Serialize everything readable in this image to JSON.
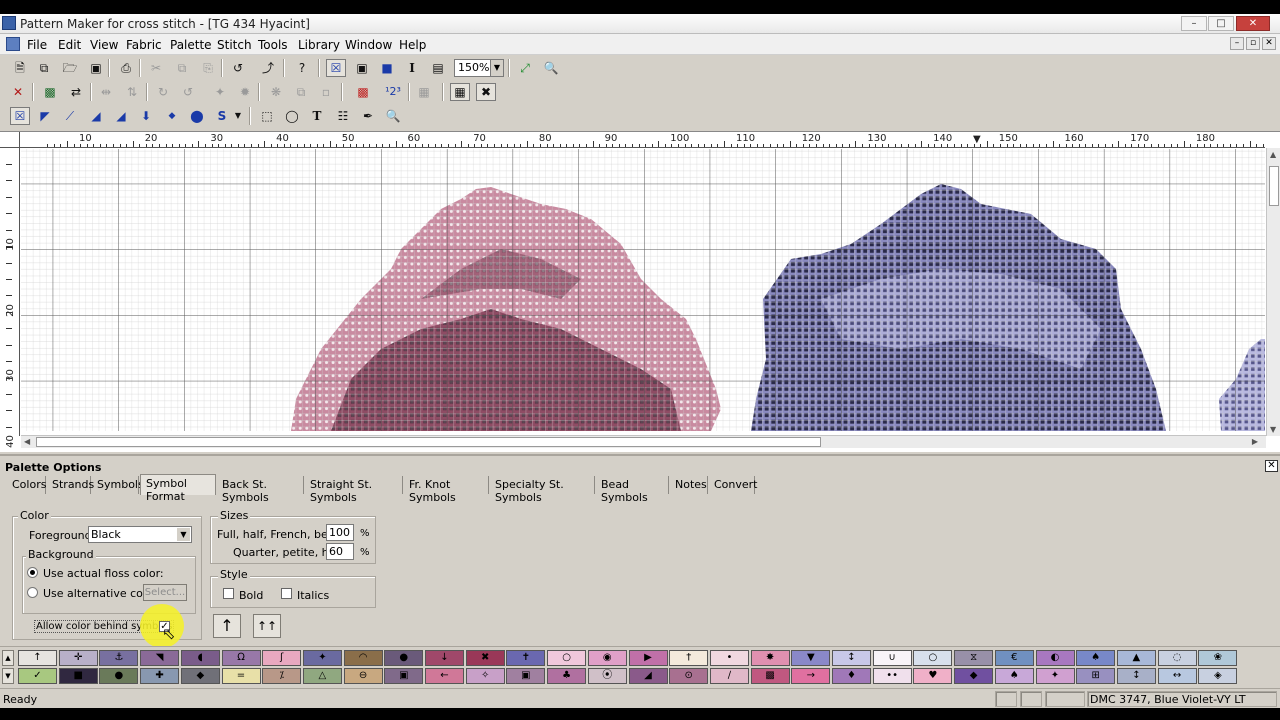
{
  "window": {
    "title": "Pattern Maker for cross stitch - [TG 434 Hyacint]",
    "min_label": "–",
    "max_label": "□",
    "close_label": "✕"
  },
  "menu": [
    "File",
    "Edit",
    "View",
    "Fabric",
    "Palette",
    "Stitch",
    "Tools",
    "Library",
    "Window",
    "Help"
  ],
  "toolbar1": {
    "zoom_value": "150%",
    "icons": [
      "new-file-icon",
      "copy-file-icon",
      "open-folder-icon",
      "save-icon",
      "print-icon",
      "cut-icon",
      "copy-icon",
      "paste-icon",
      "undo-icon",
      "redo-icon",
      "help-icon",
      "full-stitch-view-icon",
      "symbol-view-icon",
      "block-view-icon",
      "text-icon",
      "pages-icon",
      "zoom-fit-icon",
      "zoom-icon"
    ]
  },
  "toolbar2": {
    "icons": [
      "delete-icon",
      "replace-color-icon",
      "swap-icon",
      "mirror-icon",
      "rotate-icon",
      "flip-icon",
      "spread-icon",
      "fill-icon",
      "pin-icon",
      "rotate-left-icon",
      "rotate-right-icon",
      "crop-icon",
      "select-all-icon",
      "shade-icon",
      "palette-icon",
      "number-icon",
      "grid-icon",
      "cross-icon"
    ]
  },
  "toolbar3": {
    "icons": [
      "full-stitch-tool-icon",
      "half-stitch-tool-icon",
      "quarter-stitch-tool-icon",
      "three-quarter-tool-icon",
      "back-stitch-tool-icon",
      "french-knot-tool-icon",
      "bead-tool-icon",
      "specialty-tool-icon",
      "rect-select-icon",
      "lasso-icon",
      "text-tool-icon",
      "fill-bucket-icon",
      "eyedropper-icon",
      "magnify-icon"
    ]
  },
  "rulers": {
    "h_labels": [
      "10",
      "20",
      "30",
      "40",
      "50",
      "60",
      "70",
      "80",
      "90",
      "100",
      "110",
      "120",
      "130",
      "140",
      "150",
      "160",
      "170",
      "180"
    ],
    "v_labels": [
      "10",
      "20",
      "30",
      "40"
    ]
  },
  "palette_panel": {
    "title": "Palette Options",
    "tabs": [
      "Colors",
      "Strands",
      "Symbols",
      "Symbol Format",
      "Back St. Symbols",
      "Straight St. Symbols",
      "Fr. Knot Symbols",
      "Specialty St. Symbols",
      "Bead Symbols",
      "Notes",
      "Convert"
    ],
    "active_tab": "Symbol Format",
    "color_group": {
      "label": "Color",
      "foreground_label": "Foreground:",
      "foreground_value": "Black",
      "background_label": "Background",
      "opt_actual": "Use actual floss color:",
      "opt_alt": "Use alternative color:",
      "select_btn": "Select...",
      "allow_color_label": "Allow color behind symbols",
      "allow_color_checked": true
    },
    "sizes_group": {
      "label": "Sizes",
      "full_label": "Full, half, French, bead:",
      "full_value": "100",
      "quarter_label": "Quarter, petite, half:",
      "quarter_value": "60",
      "unit": "%"
    },
    "style_group": {
      "label": "Style",
      "bold_label": "Bold",
      "italics_label": "Italics"
    }
  },
  "swatches": {
    "top_row": [
      {
        "color": "#e6e4e0",
        "symbol": "↑"
      },
      {
        "color": "#b8b0c8",
        "symbol": "✛"
      },
      {
        "color": "#7870a0",
        "symbol": "⚓"
      },
      {
        "color": "#8a6a98",
        "symbol": "◥"
      },
      {
        "color": "#7a5c8a",
        "symbol": "◖"
      },
      {
        "color": "#9878a8",
        "symbol": "Ω"
      },
      {
        "color": "#e8a8c0",
        "symbol": "ʃ"
      },
      {
        "color": "#6a6aa0",
        "symbol": "✦"
      },
      {
        "color": "#8a6e4a",
        "symbol": "◠"
      },
      {
        "color": "#6a5a7a",
        "symbol": "●"
      },
      {
        "color": "#a0486a",
        "symbol": "↓"
      },
      {
        "color": "#9a3858",
        "symbol": "✖"
      },
      {
        "color": "#6a68b0",
        "symbol": "✝"
      },
      {
        "color": "#f0c8dc",
        "symbol": "○"
      },
      {
        "color": "#e0a0c8",
        "symbol": "◉"
      },
      {
        "color": "#c070a8",
        "symbol": "▶"
      },
      {
        "color": "#f4eadc",
        "symbol": "†"
      },
      {
        "color": "#f0d8e0",
        "symbol": "•"
      },
      {
        "color": "#e090b0",
        "symbol": "✸"
      },
      {
        "color": "#8a88c8",
        "symbol": "▼"
      },
      {
        "color": "#c8c8e8",
        "symbol": "↕"
      },
      {
        "color": "#f8f4f8",
        "symbol": "∪"
      },
      {
        "color": "#d8e0ec",
        "symbol": "○"
      },
      {
        "color": "#9890a8",
        "symbol": "⧖"
      },
      {
        "color": "#7090c0",
        "symbol": "€"
      },
      {
        "color": "#a878c0",
        "symbol": "◐"
      },
      {
        "color": "#7888c8",
        "symbol": "♠"
      },
      {
        "color": "#a8b8d8",
        "symbol": "▲"
      },
      {
        "color": "#c8d0e0",
        "symbol": "◌"
      },
      {
        "color": "#b0c8d8",
        "symbol": "❀"
      }
    ],
    "bottom_row": [
      {
        "color": "#a8c880",
        "symbol": "✓"
      },
      {
        "color": "#302840",
        "symbol": "■"
      },
      {
        "color": "#6a7a5a",
        "symbol": "●"
      },
      {
        "color": "#8898b0",
        "symbol": "✚"
      },
      {
        "color": "#707078",
        "symbol": "◆"
      },
      {
        "color": "#e8e0a8",
        "symbol": "="
      },
      {
        "color": "#b89888",
        "symbol": "⁒"
      },
      {
        "color": "#90a880",
        "symbol": "△"
      },
      {
        "color": "#c8a880",
        "symbol": "⊖"
      },
      {
        "color": "#806a8a",
        "symbol": "▣"
      },
      {
        "color": "#d07898",
        "symbol": "←"
      },
      {
        "color": "#c8a0c8",
        "symbol": "✧"
      },
      {
        "color": "#a080a0",
        "symbol": "▣"
      },
      {
        "color": "#b070a0",
        "symbol": "♣"
      },
      {
        "color": "#d0c0c8",
        "symbol": "⦿"
      },
      {
        "color": "#8a5a8a",
        "symbol": "◢"
      },
      {
        "color": "#a87090",
        "symbol": "⊙"
      },
      {
        "color": "#e0b8c8",
        "symbol": "∕"
      },
      {
        "color": "#c05880",
        "symbol": "▩"
      },
      {
        "color": "#e070a0",
        "symbol": "→"
      },
      {
        "color": "#a078b8",
        "symbol": "♦"
      },
      {
        "color": "#f0e0ec",
        "symbol": "••"
      },
      {
        "color": "#f0b0c8",
        "symbol": "♥"
      },
      {
        "color": "#7050a0",
        "symbol": "◆"
      },
      {
        "color": "#c8a8d8",
        "symbol": "♠"
      },
      {
        "color": "#d0a0d0",
        "symbol": "✦"
      },
      {
        "color": "#9890c0",
        "symbol": "⊞"
      },
      {
        "color": "#a8b0c8",
        "symbol": "↕"
      },
      {
        "color": "#b8c8e0",
        "symbol": "↔"
      },
      {
        "color": "#c8d0e0",
        "symbol": "◈"
      }
    ]
  },
  "status": {
    "text": "Ready",
    "floss": "DMC  3747, Blue Violet-VY LT"
  }
}
